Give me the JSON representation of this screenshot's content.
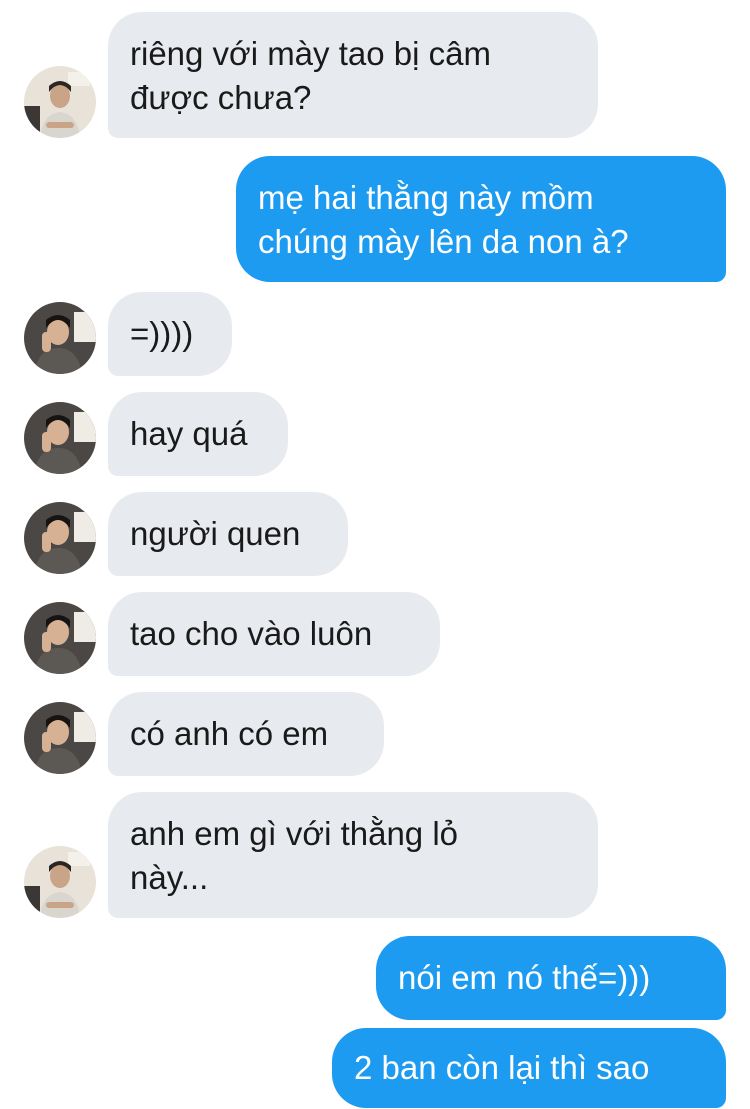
{
  "messages": [
    {
      "side": "incoming",
      "avatar": "avatar-light",
      "lines": [
        "riêng với mày tao bị câm",
        "được chưa?"
      ]
    },
    {
      "side": "outgoing",
      "lines": [
        "mẹ hai thằng này mồm",
        "chúng mày lên da non à?"
      ]
    },
    {
      "side": "incoming",
      "avatar": "avatar-dark",
      "lines": [
        "=))))"
      ]
    },
    {
      "side": "incoming",
      "avatar": "avatar-dark",
      "lines": [
        "hay quá"
      ]
    },
    {
      "side": "incoming",
      "avatar": "avatar-dark",
      "lines": [
        "người quen"
      ]
    },
    {
      "side": "incoming",
      "avatar": "avatar-dark",
      "lines": [
        "tao cho vào luôn"
      ]
    },
    {
      "side": "incoming",
      "avatar": "avatar-dark",
      "lines": [
        "có anh có em"
      ]
    },
    {
      "side": "incoming",
      "avatar": "avatar-light",
      "lines": [
        "anh em gì với thằng lỏ",
        "này..."
      ]
    },
    {
      "side": "outgoing",
      "lines": [
        "nói em nó thế=)))"
      ]
    },
    {
      "side": "outgoing",
      "lines": [
        "2 ban còn lại thì sao"
      ]
    }
  ],
  "colors": {
    "incoming_bubble": "#e7eaee",
    "outgoing_bubble": "#1d9bf0",
    "incoming_text": "#1a1a1a",
    "outgoing_text": "#ffffff"
  }
}
